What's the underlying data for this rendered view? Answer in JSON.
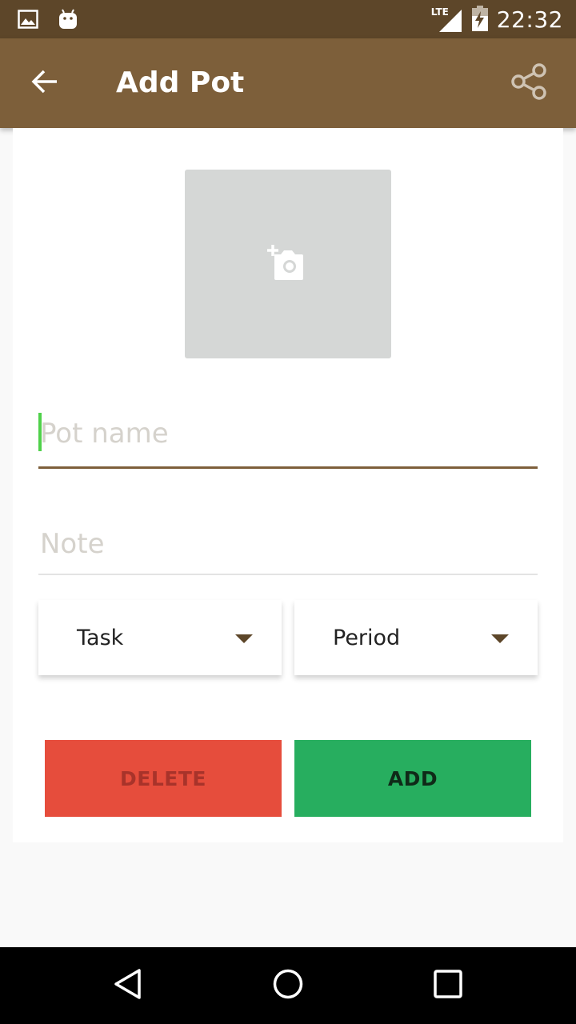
{
  "status_bar": {
    "time": "22:32",
    "network": "LTE",
    "icons": [
      "gallery-icon",
      "android-icon",
      "lte-signal-icon",
      "battery-charging-icon"
    ]
  },
  "app_bar": {
    "title": "Add Pot",
    "back_icon": "arrow-left-icon",
    "share_icon": "share-icon",
    "color": "#7d5f3a"
  },
  "form": {
    "photo_icon": "add-photo-icon",
    "pot_name": {
      "value": "",
      "placeholder": "Pot name"
    },
    "note": {
      "value": "",
      "placeholder": "Note"
    },
    "task_spinner": {
      "label": "Task"
    },
    "period_spinner": {
      "label": "Period"
    },
    "delete_label": "DELETE",
    "add_label": "ADD",
    "delete_color": "#e64d3c",
    "add_color": "#27ae5f"
  },
  "nav_bar": {
    "icons": [
      "nav-back-icon",
      "nav-home-icon",
      "nav-recent-icon"
    ]
  }
}
